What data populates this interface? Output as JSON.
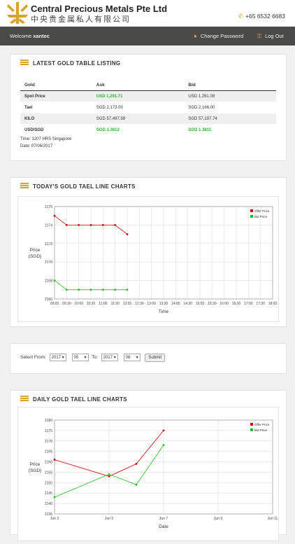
{
  "brand": {
    "name_en": "Central Precious Metals Pte Ltd",
    "name_cn": "中央贵金属私人有限公司",
    "phone": "+65 6532 6683"
  },
  "nav": {
    "welcome_prefix": "Welcome",
    "username": "xantec",
    "change_password": "Change Password",
    "logout": "Log Out"
  },
  "latest": {
    "title": "LATEST GOLD TABLE LISTING",
    "headers": [
      "Gold",
      "Ask",
      "Bid"
    ],
    "rows": [
      {
        "gold": "Spot Price",
        "ask": "USD 1,291.71",
        "bid": "USD 1,291.08"
      },
      {
        "gold": "Tael",
        "ask": "SGD 2,173.00",
        "bid": "SGD 2,166.00"
      },
      {
        "gold": "KILO",
        "ask": "SGD 57,497.58",
        "bid": "SGD 57,197.74"
      },
      {
        "gold": "USD/SGD",
        "ask": "SGD 1.3812",
        "bid": "SGD 1.3811"
      }
    ],
    "time": "Time: 1207 HRS Singapore",
    "date": "Date: 07/06/2017"
  },
  "today_chart_title": "TODAY'S GOLD TAEL LINE CHARTS",
  "daily_chart_title": "DAILY GOLD TAEL LINE CHARTS",
  "colors": {
    "offer": "#cc0000",
    "bid": "#22bb22",
    "accent": "#e0a52a"
  },
  "select_form": {
    "from_label": "Select From:",
    "to_label": "To:",
    "from_year": "2017",
    "from_month": "05",
    "to_year": "2017",
    "to_month": "06",
    "submit": "Submit"
  },
  "chart_data": [
    {
      "type": "line",
      "title": "TODAY'S GOLD TAEL LINE CHARTS",
      "xlabel": "Time",
      "ylabel": "Price (SGD)",
      "ylim": [
        2166,
        2176
      ],
      "yticks": [
        2166,
        2168,
        2170,
        2172,
        2174,
        2176
      ],
      "categories": [
        "09:00",
        "09:30",
        "10:00",
        "10:30",
        "11:00",
        "11:30",
        "12:00",
        "12:30",
        "13:00",
        "13:30",
        "14:00",
        "14:30",
        "15:00",
        "15:30",
        "16:00",
        "16:30",
        "17:00",
        "17:30",
        "18:00"
      ],
      "series": [
        {
          "name": "Offer Price",
          "values": [
            2175,
            2174,
            2174,
            2174,
            2174,
            2174,
            2173
          ]
        },
        {
          "name": "Bid Price",
          "values": [
            2168,
            2167,
            2167,
            2167,
            2167,
            2167,
            2167
          ]
        }
      ],
      "legend": "top-right",
      "grid": true
    },
    {
      "type": "line",
      "title": "DAILY GOLD TAEL LINE CHARTS",
      "xlabel": "Date",
      "ylabel": "Price (SGD)",
      "ylim": [
        2135,
        2180
      ],
      "yticks": [
        2135,
        2140,
        2145,
        2150,
        2155,
        2160,
        2165,
        2170,
        2175,
        2180
      ],
      "x_ticks": [
        "Jun 3",
        "Jun 5",
        "Jun 7",
        "Jun 9",
        "Jun 11"
      ],
      "x_range": [
        3,
        11
      ],
      "series": [
        {
          "name": "Offer Price",
          "x": [
            3,
            5,
            6,
            7
          ],
          "values": [
            2161,
            2153,
            2159,
            2175
          ]
        },
        {
          "name": "Bid Price",
          "x": [
            3,
            5,
            6,
            7
          ],
          "values": [
            2143,
            2154,
            2149,
            2168
          ]
        }
      ],
      "legend": "top-right",
      "grid": true
    }
  ]
}
